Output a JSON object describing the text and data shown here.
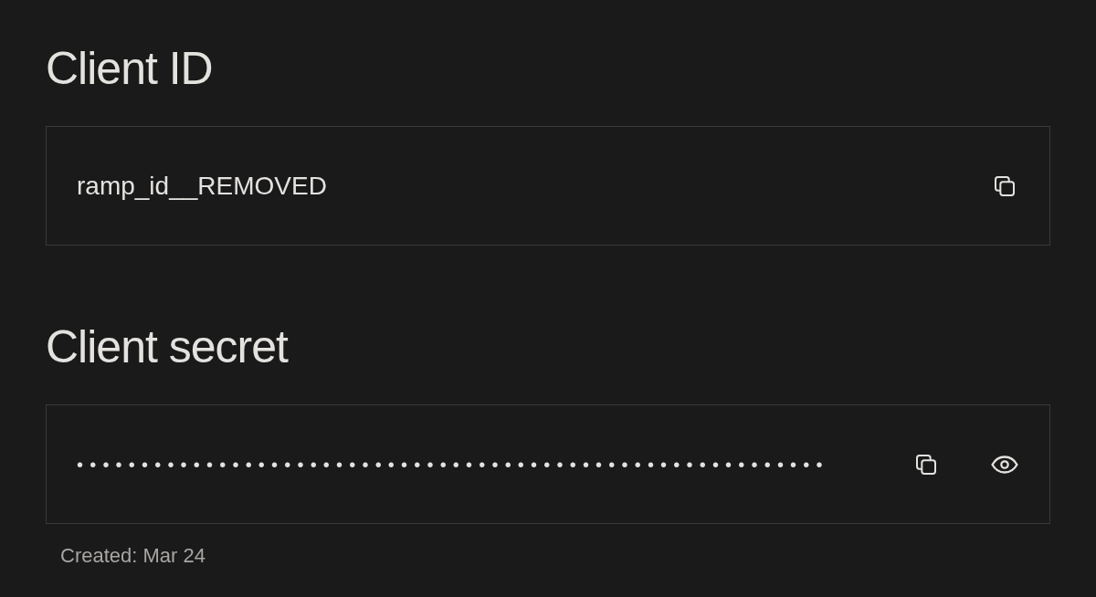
{
  "client_id": {
    "heading": "Client ID",
    "value": "ramp_id__REMOVED"
  },
  "client_secret": {
    "heading": "Client secret",
    "value": "••••••••••••••••••••••••••••••••••••••••••••••••••••••••••",
    "created": "Created: Mar 24"
  }
}
